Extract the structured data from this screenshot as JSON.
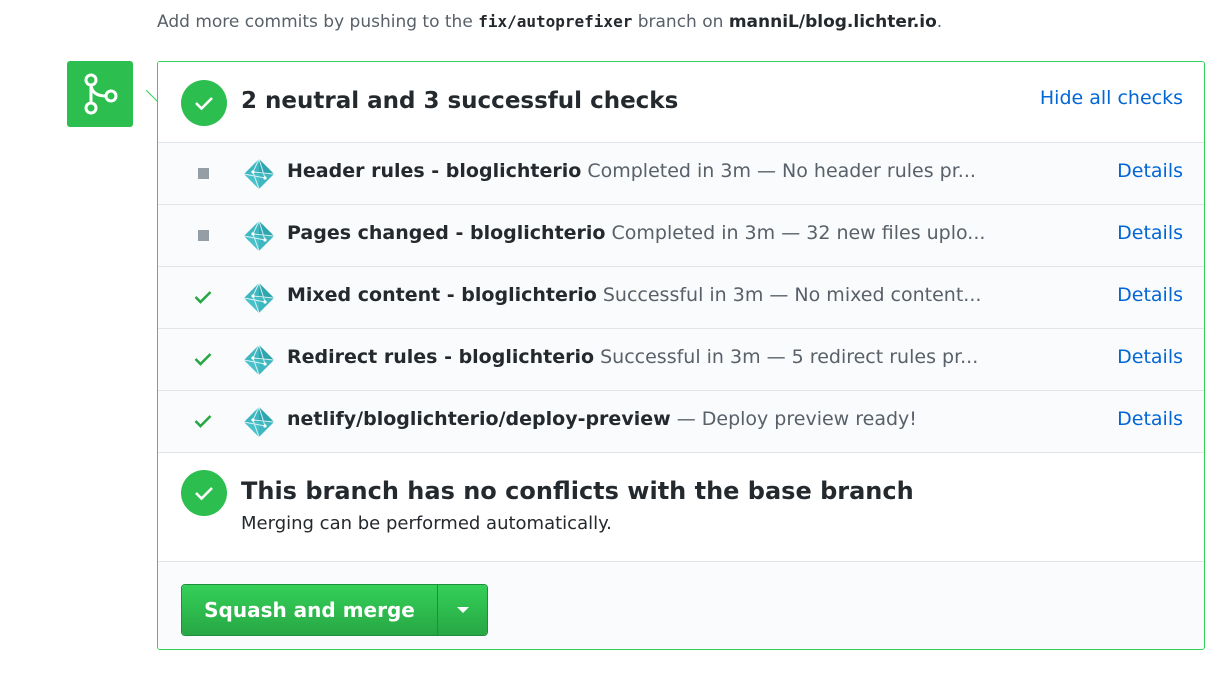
{
  "top_note": {
    "prefix": "Add more commits by pushing to the ",
    "branch": "fix/autoprefixer",
    "middle": " branch on ",
    "repo": "manniL/blog.lichter.io",
    "suffix": "."
  },
  "checks": {
    "title": "2 neutral and 3 successful checks",
    "hide_label": "Hide all checks",
    "details_label": "Details",
    "items": [
      {
        "status": "neutral",
        "name": "Header rules - bloglichterio",
        "description": "Completed in 3m — No header rules pr..."
      },
      {
        "status": "neutral",
        "name": "Pages changed - bloglichterio",
        "description": "Completed in 3m — 32 new files uplo..."
      },
      {
        "status": "success",
        "name": "Mixed content - bloglichterio",
        "description": "Successful in 3m — No mixed content..."
      },
      {
        "status": "success",
        "name": "Redirect rules - bloglichterio",
        "description": "Successful in 3m — 5 redirect rules pr..."
      },
      {
        "status": "success",
        "name": "netlify/bloglichterio/deploy-preview",
        "description": "— Deploy preview ready!"
      }
    ]
  },
  "conflicts": {
    "title": "This branch has no conflicts with the base branch",
    "subtitle": "Merging can be performed automatically."
  },
  "merge": {
    "button_label": "Squash and merge"
  },
  "colors": {
    "success_green": "#2cbe4e",
    "link_blue": "#0366d6",
    "neutral_gray": "#959da5",
    "netlify_teal": "#3fb7c0"
  }
}
